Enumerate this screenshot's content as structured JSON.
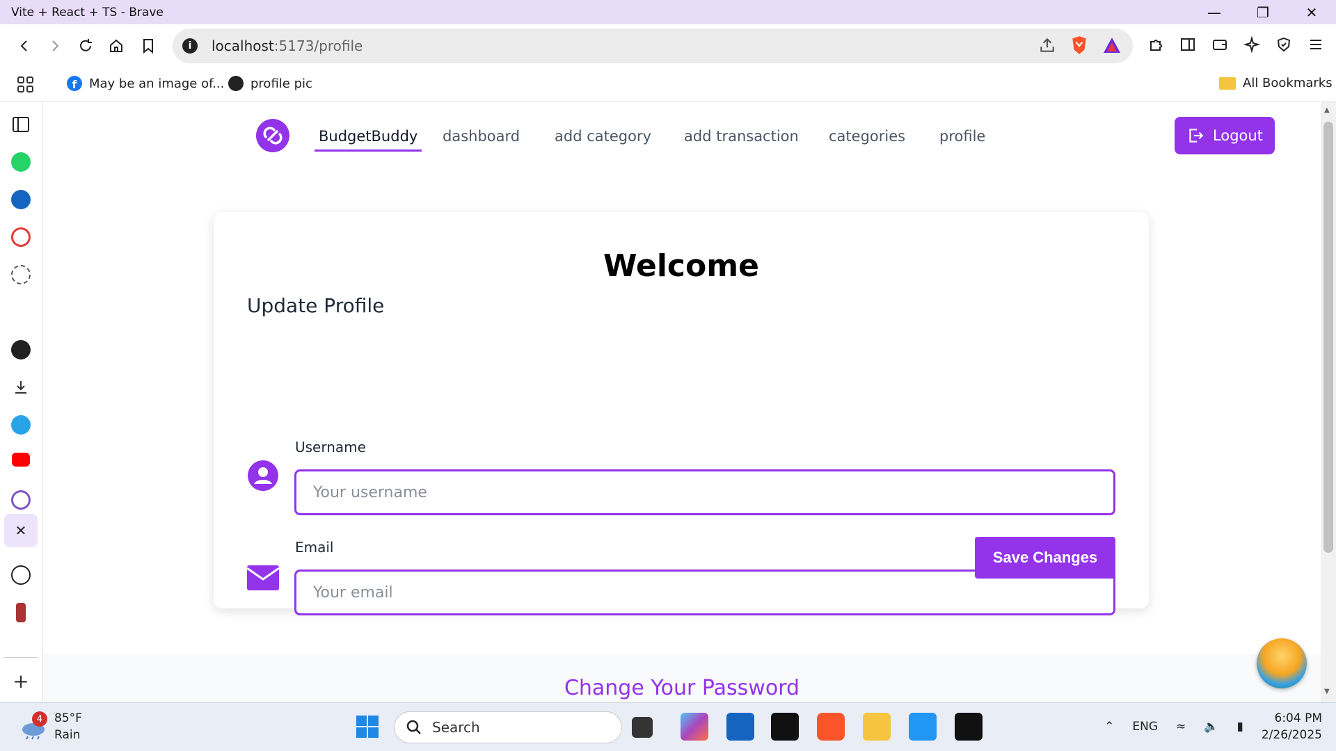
{
  "browser": {
    "window_title": "Vite + React + TS - Brave",
    "url_host": "localhost",
    "url_path": ":5173/profile",
    "bookmarks": [
      {
        "label": "May be an image of..."
      },
      {
        "label": "profile pic"
      }
    ],
    "all_bookmarks_label": "All Bookmarks"
  },
  "app": {
    "brand": "BudgetBuddy",
    "nav": [
      {
        "label": "dashboard"
      },
      {
        "label": "add category"
      },
      {
        "label": "add transaction"
      },
      {
        "label": "categories"
      },
      {
        "label": "profile"
      }
    ],
    "logout_label": "Logout",
    "accent_color": "#9333ea"
  },
  "profile_card": {
    "heading": "Welcome",
    "subheading": "Update Profile",
    "username_label": "Username",
    "username_placeholder": "Your username",
    "username_value": "",
    "email_label": "Email",
    "email_placeholder": "Your email",
    "email_value": "",
    "save_label": "Save Changes"
  },
  "password_section": {
    "title": "Change Your Password"
  },
  "taskbar": {
    "weather_temp": "85°F",
    "weather_desc": "Rain",
    "weather_badge": "4",
    "search_placeholder": "Search",
    "language": "ENG",
    "time": "6:04 PM",
    "date": "2/26/2025"
  }
}
